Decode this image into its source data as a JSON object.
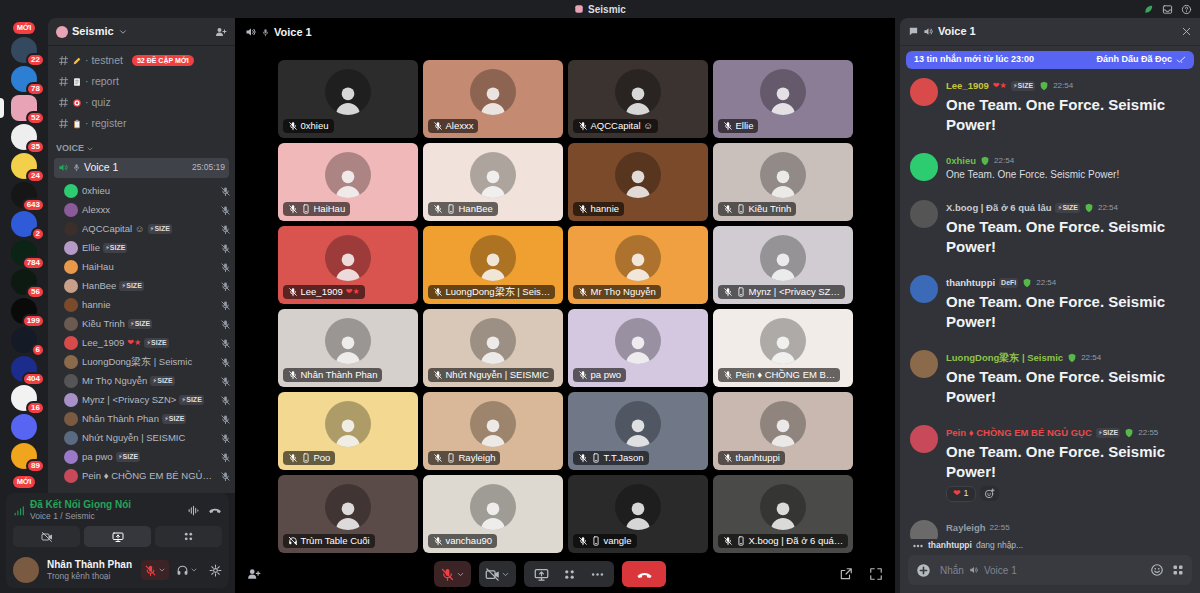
{
  "window": {
    "title": "Seismic"
  },
  "rail": {
    "new_top": "MỚI",
    "new_bottom": "MỚI",
    "servers": [
      {
        "badge": "22",
        "color": "#34495e",
        "selected": false
      },
      {
        "badge": "78",
        "color": "#2d7fd3",
        "selected": false
      },
      {
        "badge": "52",
        "color": "#e9a3b6",
        "selected": true
      },
      {
        "badge": "35",
        "color": "#eeeeee",
        "selected": false
      },
      {
        "badge": "24",
        "color": "#f3d04a",
        "selected": false
      },
      {
        "badge": "643",
        "color": "#161616",
        "selected": false
      },
      {
        "badge": "2",
        "color": "#2f5bd8",
        "selected": false
      },
      {
        "badge": "784",
        "color": "#0c2416",
        "selected": false
      },
      {
        "badge": "56",
        "color": "#0d1a12",
        "selected": false
      },
      {
        "badge": "199",
        "color": "#0a0a0a",
        "selected": false
      },
      {
        "badge": "6",
        "color": "#141b26",
        "selected": false
      },
      {
        "badge": "404",
        "color": "#1c2c8c",
        "selected": false
      },
      {
        "badge": "16",
        "color": "#f2f2f2",
        "selected": false
      },
      {
        "color": "#5865f2",
        "selected": false
      },
      {
        "badge": "89",
        "color": "#f0a51c",
        "selected": false
      }
    ]
  },
  "sidebar": {
    "server": "Seismic",
    "mention_badge": "52 ĐỀ CẬP MỚI",
    "channels": [
      "· testnet",
      "· report",
      "· quiz",
      "· register"
    ],
    "voice_category": "VOICE",
    "voice_channel": {
      "name": "Voice 1",
      "timer": "25:05:19",
      "selected": true
    },
    "members": [
      {
        "name": "0xhieu",
        "color": "#2ecc71",
        "muted": true
      },
      {
        "name": "Alexxx",
        "color": "#8a5a9a",
        "muted": true
      },
      {
        "name": "AQCCapital ☺",
        "tag": "⚡SIZE",
        "color": "#3a2f2a",
        "muted": true
      },
      {
        "name": "Ellie",
        "tag": "⚡SIZE",
        "color": "#b59ac8",
        "muted": true
      },
      {
        "name": "HaiHau",
        "color": "#e89a4a",
        "muted": true
      },
      {
        "name": "HanBee",
        "tag": "⚡SIZE",
        "color": "#c8a08a",
        "muted": true
      },
      {
        "name": "hannie",
        "color": "#7a4a2a",
        "muted": true
      },
      {
        "name": "Kiều Trinh",
        "tag": "⚡SIZE",
        "color": "#6a5a50",
        "muted": true
      },
      {
        "name": "Lee_1909",
        "deco": "❤★",
        "tag": "⚡SIZE",
        "color": "#d94a4a",
        "muted": true
      },
      {
        "name": "LuongDong梁东 | Seismic",
        "color": "#8a6a4a",
        "muted": true
      },
      {
        "name": "Mr Thọ Nguyễn",
        "tag": "⚡SIZE",
        "color": "#555555",
        "muted": true
      },
      {
        "name": "Mynz | <Privacy SZN>",
        "tag": "⚡SIZE",
        "color": "#a890c8",
        "muted": true
      },
      {
        "name": "Nhân Thành Phan",
        "tag": "⚡SIZE",
        "color": "#7a5a40",
        "muted": true
      },
      {
        "name": "Nhứt Nguyễn | SEISMIC",
        "color": "#5a6a80",
        "muted": true
      },
      {
        "name": "pa pwo",
        "tag": "⚡SIZE",
        "color": "#9a7ac8",
        "muted": true
      },
      {
        "name": "Pein ♦ CHỒNG EM BÉ NGỦ…",
        "color": "#c84a5a",
        "muted": true
      }
    ]
  },
  "voice_status": {
    "title": "Đã Kết Nối Giọng Nói",
    "subtitle": "Voice 1 / Seismic"
  },
  "user": {
    "name": "Nhân Thành Phan",
    "status": "Trong kênh thoại",
    "muted": true,
    "color": "#7a5a40"
  },
  "stage": {
    "channel": "Voice 1",
    "tiles": [
      {
        "name": "0xhieu",
        "color": "#2c2c2c",
        "mobile": false,
        "deafened": false
      },
      {
        "name": "Alexxx",
        "color": "#c48a72",
        "mobile": false,
        "deafened": false
      },
      {
        "name": "AQCCapital ☺",
        "color": "#3a3330",
        "mobile": false,
        "deafened": false
      },
      {
        "name": "Ellie",
        "color": "#8c7d96",
        "mobile": false,
        "deafened": false
      },
      {
        "name": "HaiHau",
        "color": "#f0b8b8",
        "mobile": true,
        "deafened": false
      },
      {
        "name": "HanBee",
        "color": "#f1e3dc",
        "mobile": true,
        "deafened": false
      },
      {
        "name": "hannie",
        "color": "#7a4a2a",
        "mobile": false,
        "deafened": false
      },
      {
        "name": "Kiều Trinh",
        "color": "#c9c0bc",
        "mobile": true,
        "deafened": false
      },
      {
        "name": "Lee_1909",
        "deco": "❤★",
        "color": "#d9534f",
        "mobile": false,
        "deafened": false
      },
      {
        "name": "LuongDong梁东 | Seis…",
        "color": "#f0a030",
        "mobile": false,
        "deafened": false
      },
      {
        "name": "Mr Thọ Nguyễn",
        "color": "#f0a040",
        "mobile": false,
        "deafened": false
      },
      {
        "name": "Mynz | <Privacy SZ…",
        "color": "#d0ccd2",
        "mobile": true,
        "deafened": false
      },
      {
        "name": "Nhân Thành Phan",
        "color": "#d6d0cc",
        "mobile": false,
        "deafened": false
      },
      {
        "name": "Nhứt Nguyễn | SEISMIC",
        "color": "#d9c8b8",
        "mobile": false,
        "deafened": false
      },
      {
        "name": "pa pwo",
        "color": "#d4c8e0",
        "mobile": false,
        "deafened": false
      },
      {
        "name": "Pein ♦ CHỒNG EM B…",
        "color": "#f2ece8",
        "mobile": false,
        "deafened": false
      },
      {
        "name": "Poo",
        "color": "#f2d890",
        "mobile": true,
        "deafened": false
      },
      {
        "name": "Rayleigh",
        "color": "#d8b898",
        "mobile": true,
        "deafened": false
      },
      {
        "name": "T.T.Jason",
        "color": "#707888",
        "mobile": true,
        "deafened": false
      },
      {
        "name": "thanhtuppi",
        "color": "#c8b8b0",
        "mobile": false,
        "deafened": false
      },
      {
        "name": "Trùm Table Cuối",
        "color": "#5a4a48",
        "mobile": false,
        "deafened": true
      },
      {
        "name": "vanchau90",
        "color": "#ddd8d0",
        "mobile": false,
        "deafened": false
      },
      {
        "name": "vangle",
        "color": "#2a2a2a",
        "mobile": true,
        "deafened": false
      },
      {
        "name": "X.boog | Đã ở 6 quá…",
        "color": "#4a4a48",
        "mobile": true,
        "deafened": false
      }
    ],
    "controls": {
      "mic_muted": true,
      "camera_off": true
    }
  },
  "chat": {
    "channel": "Voice 1",
    "banner": {
      "text": "13 tin nhắn mới từ lúc 23:00",
      "action": "Đánh Dấu Đã Đọc"
    },
    "messages": [
      {
        "author": "Lee_1909",
        "color": "#c9c63c",
        "avatar": "#d94a4a",
        "deco": "❤★",
        "tag": "⚡SIZE",
        "time": "22:54",
        "text": "One Team. One Force. Seismic Power!",
        "kind": "heading"
      },
      {
        "author": "0xhieu",
        "color": "#6fbf4a",
        "avatar": "#2ecc71",
        "time": "22:54",
        "text": "One Team. One Force. Seismic Power!",
        "kind": "text"
      },
      {
        "author": "X.boog | Đã ở 6 quá lâu",
        "color": "#c9ccd1",
        "avatar": "#555555",
        "tag": "⚡SIZE",
        "time": "22:54",
        "text": "One Team. One Force. Seismic Power!",
        "kind": "heading"
      },
      {
        "author": "thanhtuppi",
        "color": "#dbdee1",
        "avatar": "#3a6ab8",
        "tag": "DeFi",
        "time": "22:54",
        "text": "One Team. One Force. Seismic Power!",
        "kind": "heading"
      },
      {
        "author": "LuongDong梁东 | Seismic",
        "color": "#8fc34a",
        "avatar": "#8a6a4a",
        "time": "22:54",
        "text": "One Team. One Force. Seismic Power!",
        "kind": "heading"
      },
      {
        "author": "Pein ♦ CHỒNG EM BÉ NGỦ GỤC",
        "color": "#e84a4a",
        "avatar": "#c84a5a",
        "tag": "⚡SIZE",
        "time": "22:55",
        "text": "One Team. One Force. Seismic Power!",
        "kind": "heading",
        "reactions": [
          {
            "emoji": "❤",
            "count": "1"
          }
        ]
      },
      {
        "author": "Rayleigh",
        "color": "#949ba4",
        "avatar": "#6a6a6a",
        "time": "22:55",
        "kind": "partial"
      }
    ],
    "typing": {
      "user": "thanhtuppi",
      "text": "đang nhập..."
    },
    "composer": {
      "prefix": "Nhắn",
      "channel": "Voice 1"
    }
  }
}
